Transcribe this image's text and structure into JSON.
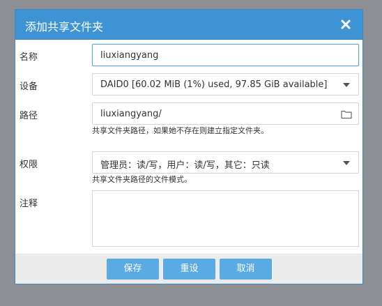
{
  "dialog": {
    "title": "添加共享文件夹",
    "close_icon": "close-icon"
  },
  "form": {
    "name": {
      "label": "名称",
      "value": "liuxiangyang"
    },
    "device": {
      "label": "设备",
      "value": "DAID0 [60.02 MiB (1%) used, 97.85 GiB available]"
    },
    "path": {
      "label": "路径",
      "value": "liuxiangyang/",
      "hint": "共享文件夹路径，如果她不存在则建立指定文件夹。",
      "icon": "folder-icon"
    },
    "permissions": {
      "label": "权限",
      "value": "管理员：读/写，用户：读/写，其它：只读",
      "hint": "共享文件夹路径的文件模式。"
    },
    "comment": {
      "label": "注释",
      "value": ""
    }
  },
  "footer": {
    "save_label": "保存",
    "reset_label": "重设",
    "cancel_label": "取消"
  },
  "colors": {
    "titlebar": "#3d93d3",
    "button": "#5aaae4",
    "backdrop": "#8d8f94"
  }
}
